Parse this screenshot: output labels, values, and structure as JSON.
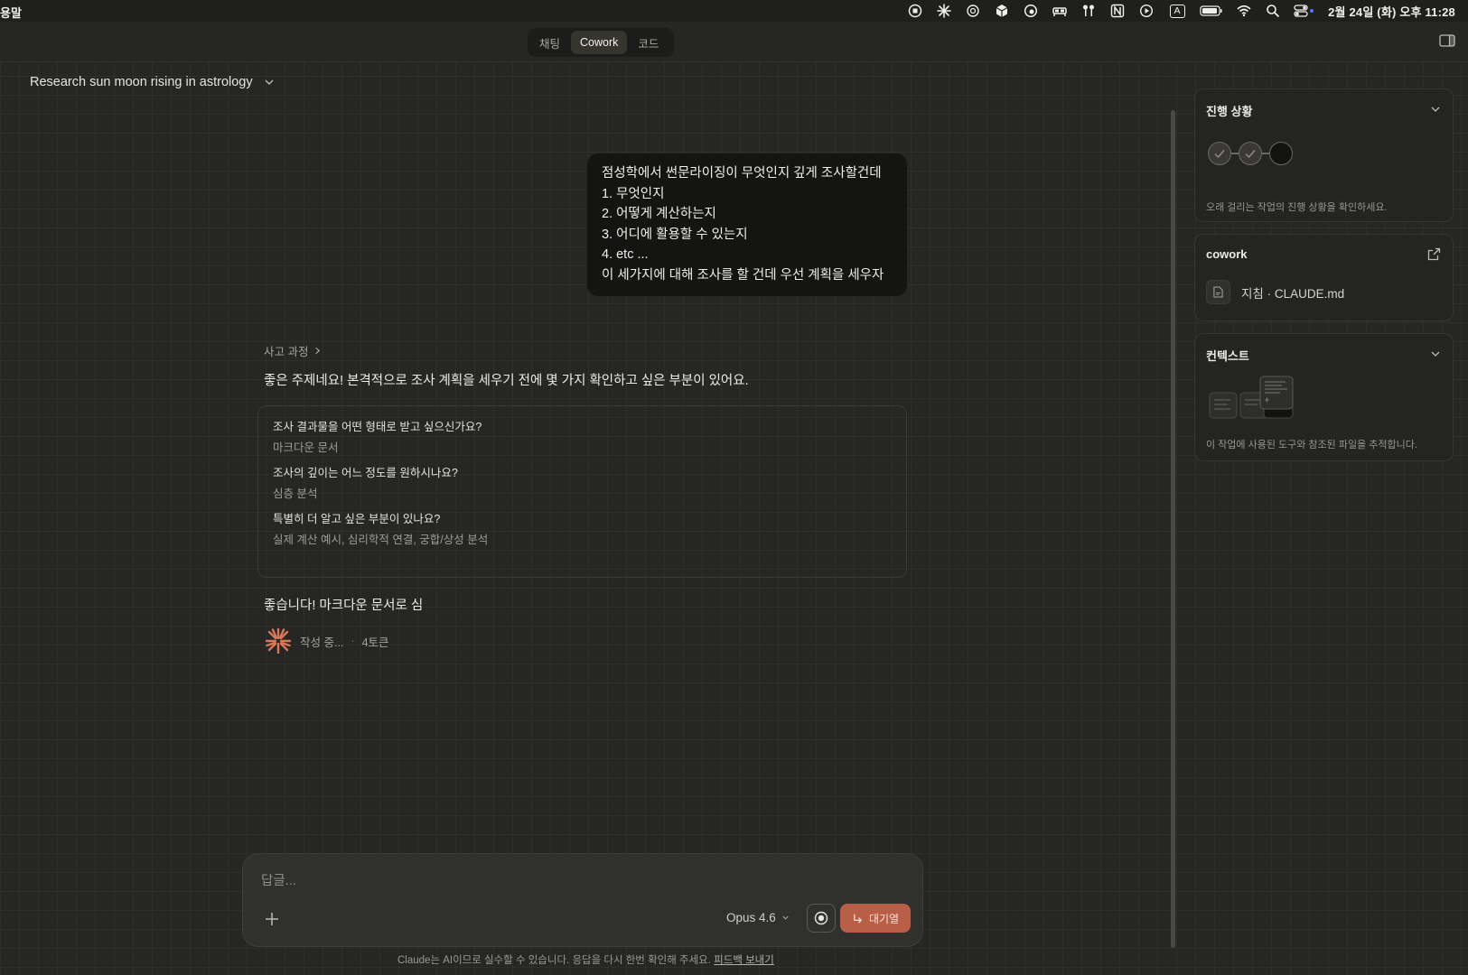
{
  "menubar": {
    "app_name": "용말",
    "clock": "2월 24일 (화) 오후 11:28",
    "icons": [
      "record-icon",
      "claude-spark-icon",
      "openai-icon",
      "cube-icon",
      "globe-icon",
      "bed-icon",
      "airpods-icon",
      "notion-icon",
      "play-icon",
      "input-source-icon",
      "battery-icon",
      "wifi-icon",
      "search-icon",
      "control-center-icon"
    ],
    "input_source_label": "A"
  },
  "topbar": {
    "tabs": [
      {
        "label": "채팅"
      },
      {
        "label": "Cowork"
      },
      {
        "label": "코드"
      }
    ],
    "active_tab": "Cowork"
  },
  "conversation": {
    "title": "Research sun moon rising in astrology",
    "user_message": {
      "lines": [
        "점성학에서 썬문라이징이 무엇인지 깊게 조사할건데",
        "1. 무엇인지",
        "2. 어떻게 계산하는지",
        "3. 어디에 활용할 수 있는지",
        "4. etc ...",
        "이 세가지에 대해 조사를 할 건데 우선 계획을 세우자"
      ]
    },
    "thinking_label": "사고 과정",
    "reply_intro": "좋은 주제네요! 본격적으로 조사 계획을 세우기 전에 몇 가지 확인하고 싶은 부분이 있어요.",
    "questions": [
      {
        "q": "조사 결과물을 어떤 형태로 받고 싶으신가요?",
        "a": "마크다운 문서"
      },
      {
        "q": "조사의 깊이는 어느 정도를 원하시나요?",
        "a": "심층 분석"
      },
      {
        "q": "특별히 더 알고 싶은 부분이 있나요?",
        "a": "실제 계산 예시, 심리학적 연결, 궁합/상성 분석"
      }
    ],
    "reply_streaming": "좋습니다! 마크다운 문서로 심",
    "status": {
      "label": "작성 중...",
      "separator": "·",
      "tokens": "4토큰"
    }
  },
  "composer": {
    "placeholder": "답글...",
    "model": "Opus 4.6",
    "queue_label": "대기열",
    "disclaimer": "Claude는 AI이므로 실수할 수 있습니다. 응답을 다시 한번 확인해 주세요.",
    "feedback_link": "피드백 보내기"
  },
  "sidebar": {
    "progress": {
      "title": "진행 상황",
      "description": "오래 걸리는 작업의 진행 상황을 확인하세요.",
      "steps": [
        "done",
        "done",
        "current"
      ]
    },
    "cowork": {
      "title": "cowork",
      "file_label": "지침 · CLAUDE.md"
    },
    "context": {
      "title": "컨텍스트",
      "description": "이 작업에 사용된 도구와 참조된 파일을 추적합니다."
    }
  },
  "colors": {
    "background": "#262624",
    "accent": "#b95f47",
    "spark": "#d97757"
  }
}
